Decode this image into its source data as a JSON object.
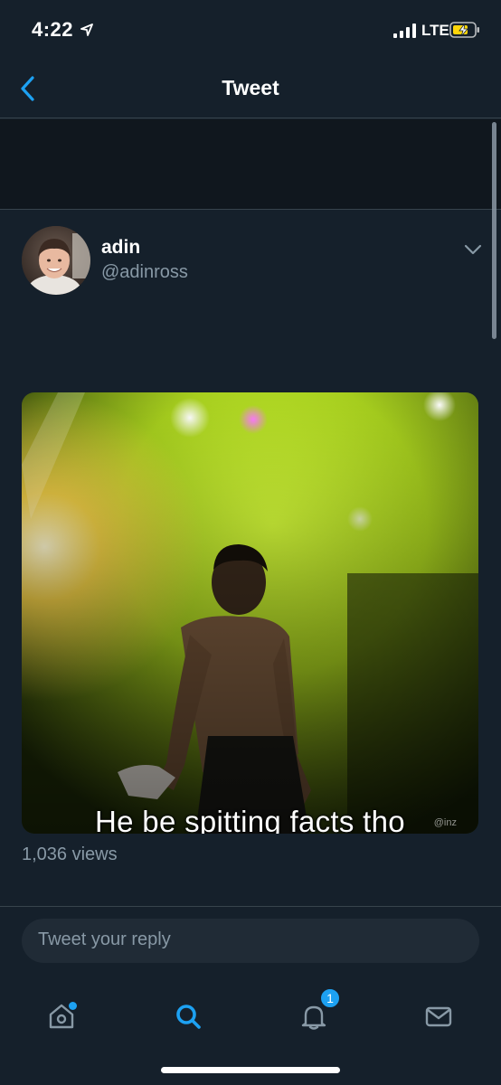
{
  "status_bar": {
    "time": "4:22",
    "network": "LTE"
  },
  "nav": {
    "title": "Tweet"
  },
  "tweet": {
    "author_name": "adin",
    "author_handle": "@adinross",
    "media_caption": "He be spitting facts tho",
    "watermark": "@inz",
    "views": "1,036 views"
  },
  "reply": {
    "placeholder": "Tweet your reply"
  },
  "tab_bar": {
    "notification_count": "1"
  },
  "colors": {
    "background": "#15202b",
    "accent": "#1da1f2",
    "secondary_text": "#8899a6",
    "divider": "#38444d"
  }
}
